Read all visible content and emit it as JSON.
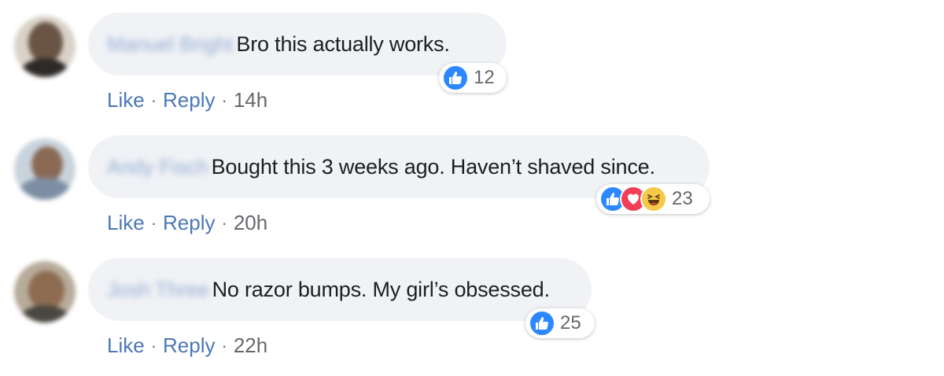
{
  "comments": [
    {
      "author": "Manuel Bright",
      "text": "Bro this actually works.",
      "reaction_count": "12",
      "reactions": [
        "like-icon"
      ],
      "actions": {
        "like": "Like",
        "reply": "Reply",
        "separator": "·",
        "time": "14h"
      }
    },
    {
      "author": "Andy Fisch",
      "text": "Bought this 3 weeks ago. Haven’t shaved since.",
      "reaction_count": "23",
      "reactions": [
        "like-icon",
        "love-icon",
        "haha-icon"
      ],
      "actions": {
        "like": "Like",
        "reply": "Reply",
        "separator": "·",
        "time": "20h"
      }
    },
    {
      "author": "Josh Three",
      "text": "No razor bumps. My girl’s obsessed.",
      "reaction_count": "25",
      "reactions": [
        "like-icon"
      ],
      "actions": {
        "like": "Like",
        "reply": "Reply",
        "separator": "·",
        "time": "22h"
      }
    }
  ],
  "colors": {
    "bubble": "#f0f2f5",
    "link": "#4b78b6",
    "like": "#2d88ff",
    "love": "#f33e58",
    "haha": "#f7c94b"
  }
}
